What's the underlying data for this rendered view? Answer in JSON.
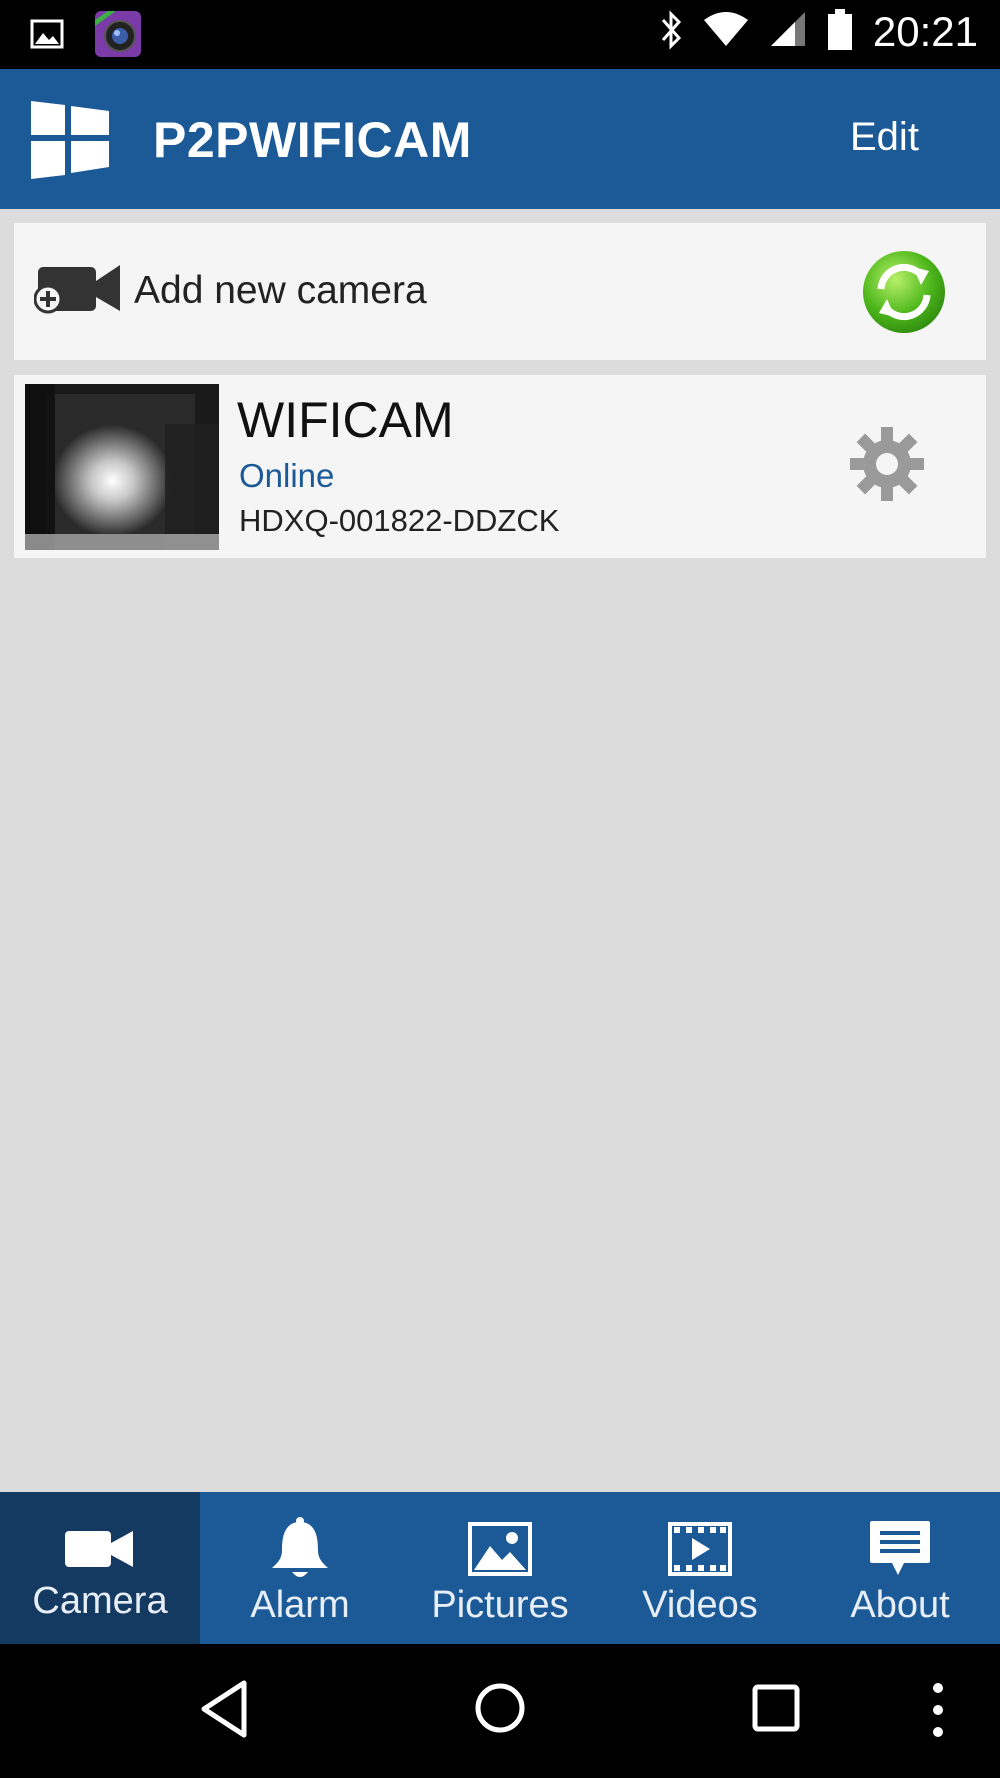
{
  "status_bar": {
    "time": "20:21",
    "left_icons": [
      "gallery-icon",
      "ipcam-app-icon"
    ],
    "right_icons": [
      "bluetooth-icon",
      "wifi-icon",
      "signal-icon",
      "battery-icon"
    ]
  },
  "app_bar": {
    "title": "P2PWIFICAM",
    "edit_label": "Edit",
    "color": "#1b5a97"
  },
  "add_camera": {
    "label": "Add new camera"
  },
  "cameras": [
    {
      "name": "WIFICAM",
      "status": "Online",
      "uid": "HDXQ-001822-DDZCK"
    }
  ],
  "tabs": [
    {
      "label": "Camera",
      "icon": "video-camera-icon",
      "active": true
    },
    {
      "label": "Alarm",
      "icon": "bell-icon",
      "active": false
    },
    {
      "label": "Pictures",
      "icon": "picture-icon",
      "active": false
    },
    {
      "label": "Videos",
      "icon": "film-icon",
      "active": false
    },
    {
      "label": "About",
      "icon": "chat-bubble-icon",
      "active": false
    }
  ],
  "nav_bar": [
    "back-icon",
    "home-icon",
    "recents-icon",
    "overflow-menu-icon"
  ]
}
